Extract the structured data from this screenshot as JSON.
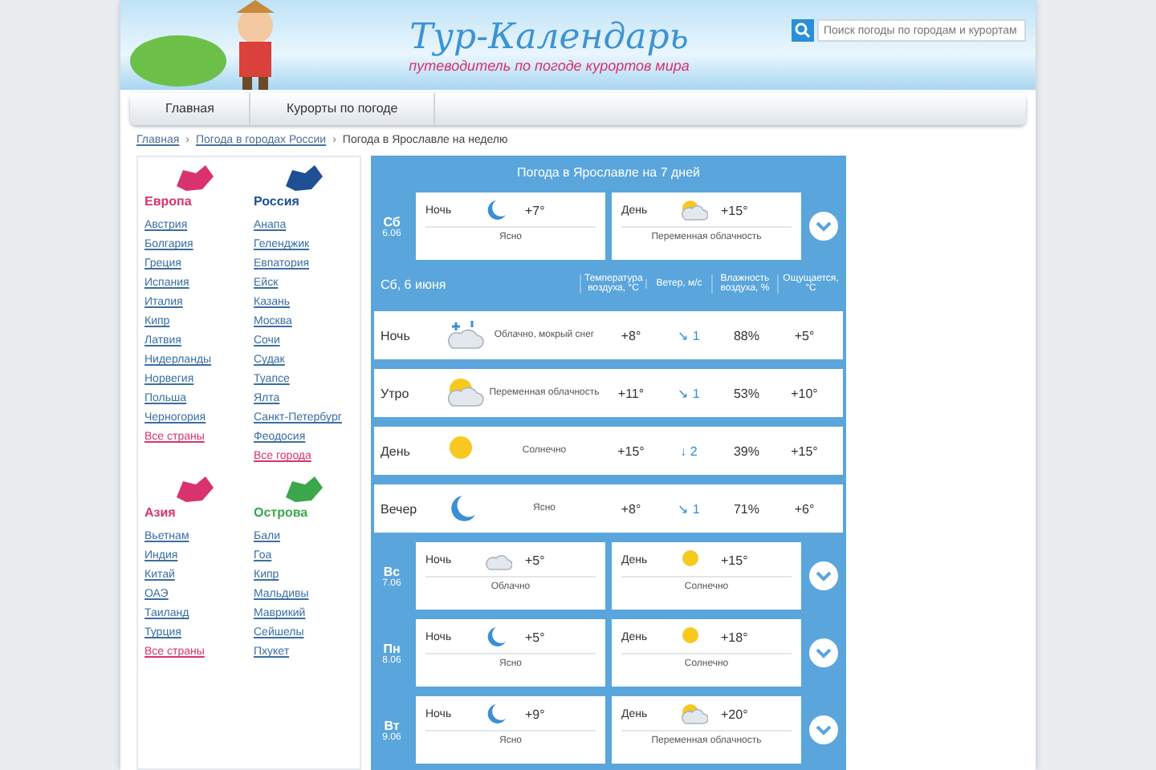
{
  "header": {
    "logo": "Тур-Календарь",
    "slogan": "путеводитель по погоде курортов мира",
    "search": {
      "placeholder": "Поиск погоды по городам и курортам"
    }
  },
  "nav": [
    {
      "label": "Главная",
      "selected": false
    },
    {
      "label": "Курорты по погоде",
      "selected": false
    }
  ],
  "breadcrumb": [
    {
      "text": "Главная"
    },
    {
      "separator": "›",
      "text": "Погода в городах России"
    },
    {
      "separator": "›",
      "text": "Погода в Ярославле на неделю"
    }
  ],
  "sidebar": [
    {
      "title": "Европа",
      "color": "#d8336f",
      "items": [
        "Австрия",
        "Болгария",
        "Греция",
        "Испания",
        "Италия",
        "Кипр",
        "Латвия",
        "Нидерланды",
        "Норвегия",
        "Польша",
        "Черногория"
      ],
      "more": "Все страны"
    },
    {
      "title": "Россия",
      "color": "#1f4f94",
      "items": [
        "Анапа",
        "Геленджик",
        "Евпатория",
        "Ейск",
        "Казань",
        "Москва",
        "Сочи",
        "Судак",
        "Туапсе",
        "Ялта",
        "Санкт-Петербург",
        "Феодосия"
      ],
      "more": "Все города"
    },
    {
      "title": "Азия",
      "color": "#d8336f",
      "items": [
        "Вьетнам",
        "Индия",
        "Китай",
        "ОАЭ",
        "Таиланд",
        "Турция"
      ],
      "more": "Все страны"
    },
    {
      "title": "Острова",
      "color": "#3aa84a",
      "items": [
        "Бали",
        "Гоа",
        "Кипр",
        "Мальдивы",
        "Маврикий",
        "Сейшелы",
        "Пхукет"
      ]
    }
  ],
  "weather": {
    "title": "Погода в Ярославле на 7 дней",
    "today": {
      "weekday": "Сб",
      "date": "6.06",
      "night": {
        "label": "Ночь",
        "kind": "moon",
        "temp": "+7°",
        "text": "Ясно"
      },
      "day": {
        "label": "День",
        "kind": "suncloud",
        "temp": "+15°",
        "text": "Переменная облачность"
      }
    },
    "columns": [
      "Сб, 6 июня",
      "Температура воздуха, °С",
      "Ветер, м/с",
      "Влажность воздуха, %",
      "Ощущается, °С"
    ],
    "rows": [
      {
        "part": "Ночь",
        "kind": "snow",
        "text": "Облачно, мокрый снег",
        "temp": "+8°",
        "wind": "↘ 1",
        "humidity": "88%",
        "feels": "+5°"
      },
      {
        "part": "Утро",
        "kind": "suncloud",
        "text": "Переменная облачность",
        "temp": "+11°",
        "wind": "↘ 1",
        "humidity": "53%",
        "feels": "+10°"
      },
      {
        "part": "День",
        "kind": "sun",
        "text": "Солнечно",
        "temp": "+15°",
        "wind": "↓ 2",
        "humidity": "39%",
        "feels": "+15°"
      },
      {
        "part": "Вечер",
        "kind": "moon",
        "text": "Ясно",
        "temp": "+8°",
        "wind": "↘ 1",
        "humidity": "71%",
        "feels": "+6°"
      }
    ],
    "days": [
      {
        "weekday": "Вс",
        "date": "7.06",
        "night": {
          "label": "Ночь",
          "kind": "cloud",
          "temp": "+5°",
          "text": "Облачно"
        },
        "day": {
          "label": "День",
          "kind": "sun",
          "temp": "+15°",
          "text": "Солнечно"
        }
      },
      {
        "weekday": "Пн",
        "date": "8.06",
        "night": {
          "label": "Ночь",
          "kind": "moon",
          "temp": "+5°",
          "text": "Ясно"
        },
        "day": {
          "label": "День",
          "kind": "sun",
          "temp": "+18°",
          "text": "Солнечно"
        }
      },
      {
        "weekday": "Вт",
        "date": "9.06",
        "night": {
          "label": "Ночь",
          "kind": "moon",
          "temp": "+9°",
          "text": "Ясно"
        },
        "day": {
          "label": "День",
          "kind": "suncloud",
          "temp": "+20°",
          "text": "Переменная облачность"
        }
      }
    ]
  }
}
